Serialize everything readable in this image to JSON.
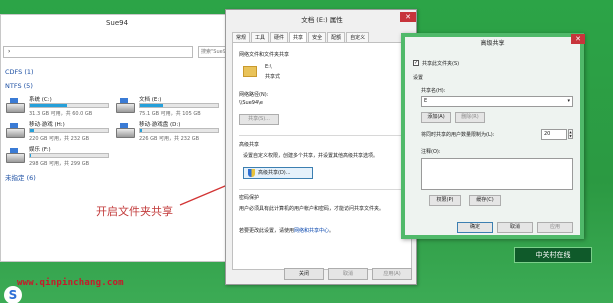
{
  "explorer": {
    "title": "Sue94",
    "address": "›",
    "search_placeholder": "搜索\"Sue94\"",
    "section_cdfs": "CDFS (1)",
    "section_ntfs": "NTFS (5)",
    "section_unspecified": "未指定 (6)",
    "drives": [
      {
        "name": "系统 (C:)",
        "free": "31.3 GB 可用，共 60.0 GB",
        "used_fraction": 0.48
      },
      {
        "name": "文档 (E:)",
        "free": "75.1 GB 可用，共 105 GB",
        "used_fraction": 0.29
      },
      {
        "name": "移动·游戏 (H:)",
        "free": "220 GB 可用，共 232 GB",
        "used_fraction": 0.05
      },
      {
        "name": "移动·游戏盘 (D:)",
        "free": "226 GB 可用，共 232 GB",
        "used_fraction": 0.03
      },
      {
        "name": "娱乐 (F:)",
        "free": "298 GB 可用，共 299 GB",
        "used_fraction": 0.01
      }
    ]
  },
  "annotation": {
    "text": "开启文件夹共享"
  },
  "properties": {
    "title": "文档 (E:) 属性",
    "close": "✕",
    "tabs": [
      "常规",
      "工具",
      "硬件",
      "共享",
      "安全",
      "配额",
      "自定义"
    ],
    "active_tab": "共享",
    "section1": "网络文件和文件夹共享",
    "folder_path": "E:\\",
    "share_state": "共享式",
    "net_path_label": "网络路径(N):",
    "net_path": "\\\\Sue94\\e",
    "share_button": "共享(S)...",
    "section2": "高级共享",
    "adv_desc": "设置自定义权限，创建多个共享，并设置其他高级共享选项。",
    "adv_button": "高级共享(D)...",
    "section3": "密码保护",
    "pwd_desc": "用户必须具有此计算机的用户帐户和密码，才能访问共享文件夹。",
    "pwd_link_prefix": "若要更改此设置，请使用",
    "pwd_link": "网络和共享中心",
    "pwd_link_suffix": "。",
    "btn_close": "关闭",
    "btn_cancel": "取消",
    "btn_apply": "应用(A)"
  },
  "advanced": {
    "title": "高级共享",
    "close": "✕",
    "share_checkbox": "共享此文件夹(S)",
    "settings": "设置",
    "share_name_label": "共享名(H):",
    "share_name": "E",
    "add_button": "添加(A)",
    "remove_button": "删除(R)",
    "limit_label": "将同时共享的用户数量限制为(L):",
    "limit_value": "20",
    "notes_label": "注释(O):",
    "perm_button": "权限(P)",
    "cache_button": "缓存(C)",
    "ok_button": "确定",
    "cancel_button": "取消",
    "apply_button": "应用"
  },
  "site_url": "www.qinpinchang.com",
  "watermark": "中关村在线"
}
